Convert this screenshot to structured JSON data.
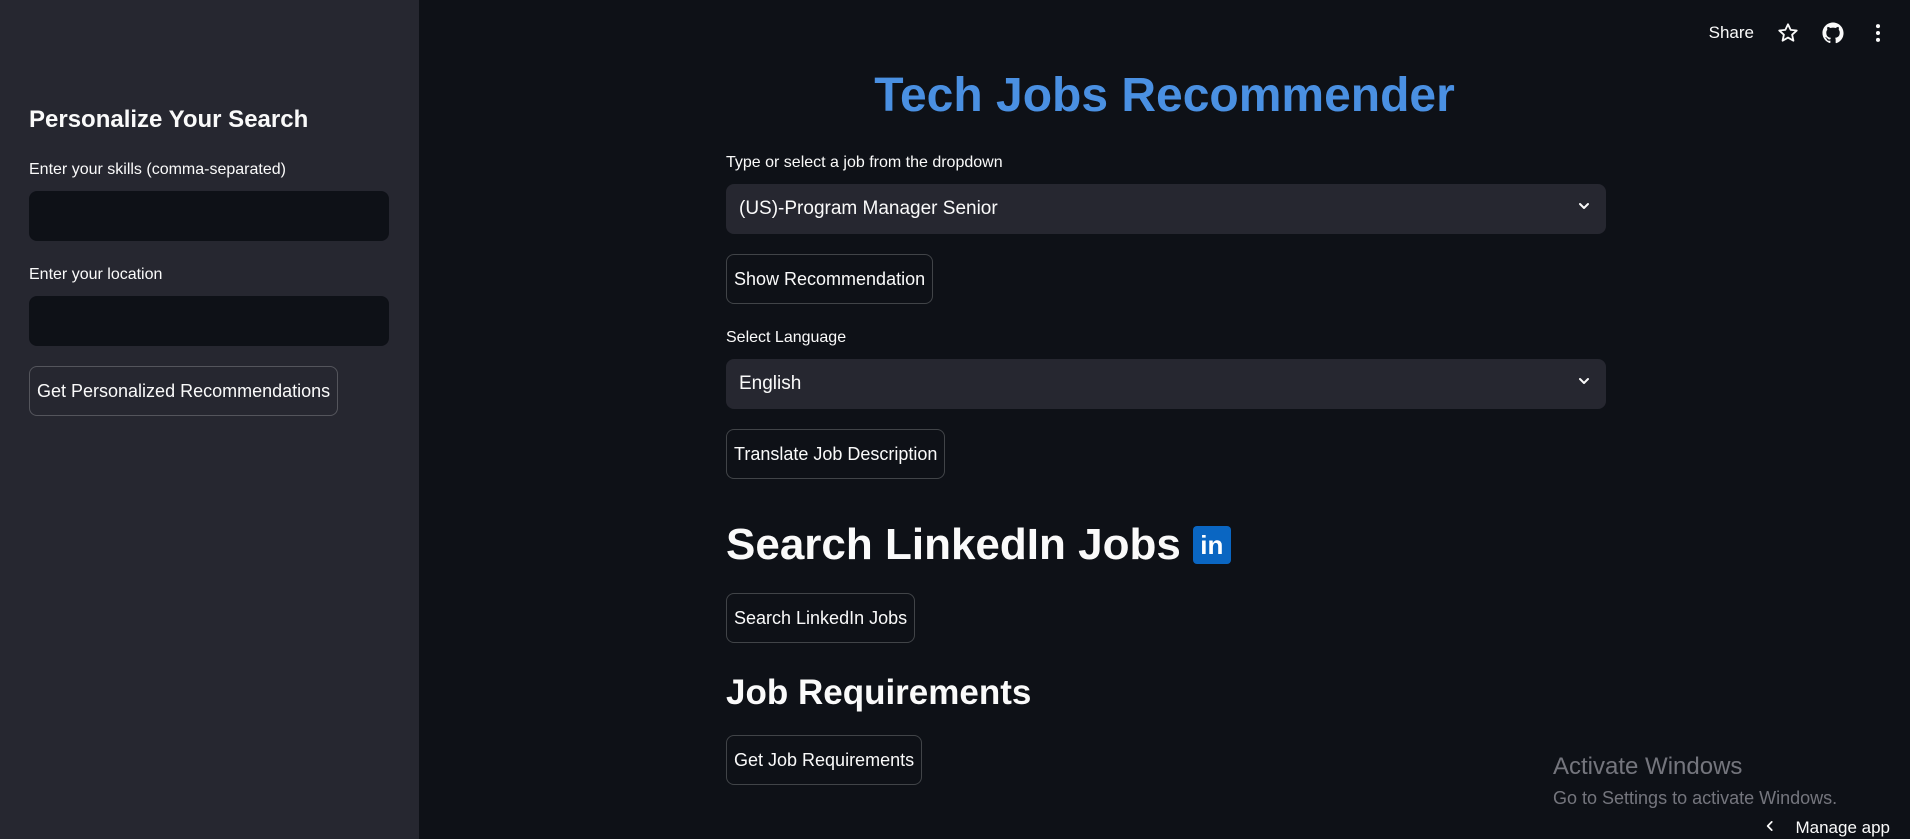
{
  "sidebar": {
    "title": "Personalize Your Search",
    "skills_label": "Enter your skills (comma-separated)",
    "skills_value": "",
    "location_label": "Enter your location",
    "location_value": "",
    "personalized_button": "Get Personalized Recommendations"
  },
  "header": {
    "share_label": "Share",
    "icons": [
      "star-icon",
      "github-icon",
      "more-vertical-icon"
    ]
  },
  "main": {
    "title": "Tech Jobs Recommender",
    "title_color": "#4a90e2",
    "job_select_label": "Type or select a job from the dropdown",
    "job_select_value": "(US)-Program Manager Senior",
    "show_recommendation_button": "Show Recommendation",
    "language_label": "Select Language",
    "language_value": "English",
    "translate_button": "Translate Job Description",
    "linkedin_heading": "Search LinkedIn Jobs",
    "linkedin_badge": "in",
    "linkedin_color": "#0a66c2",
    "search_linkedin_button": "Search LinkedIn Jobs",
    "requirements_heading": "Job Requirements",
    "requirements_button": "Get Job Requirements"
  },
  "watermark": {
    "title": "Activate Windows",
    "subtitle": "Go to Settings to activate Windows."
  },
  "footer": {
    "manage_app_label": "Manage app"
  }
}
